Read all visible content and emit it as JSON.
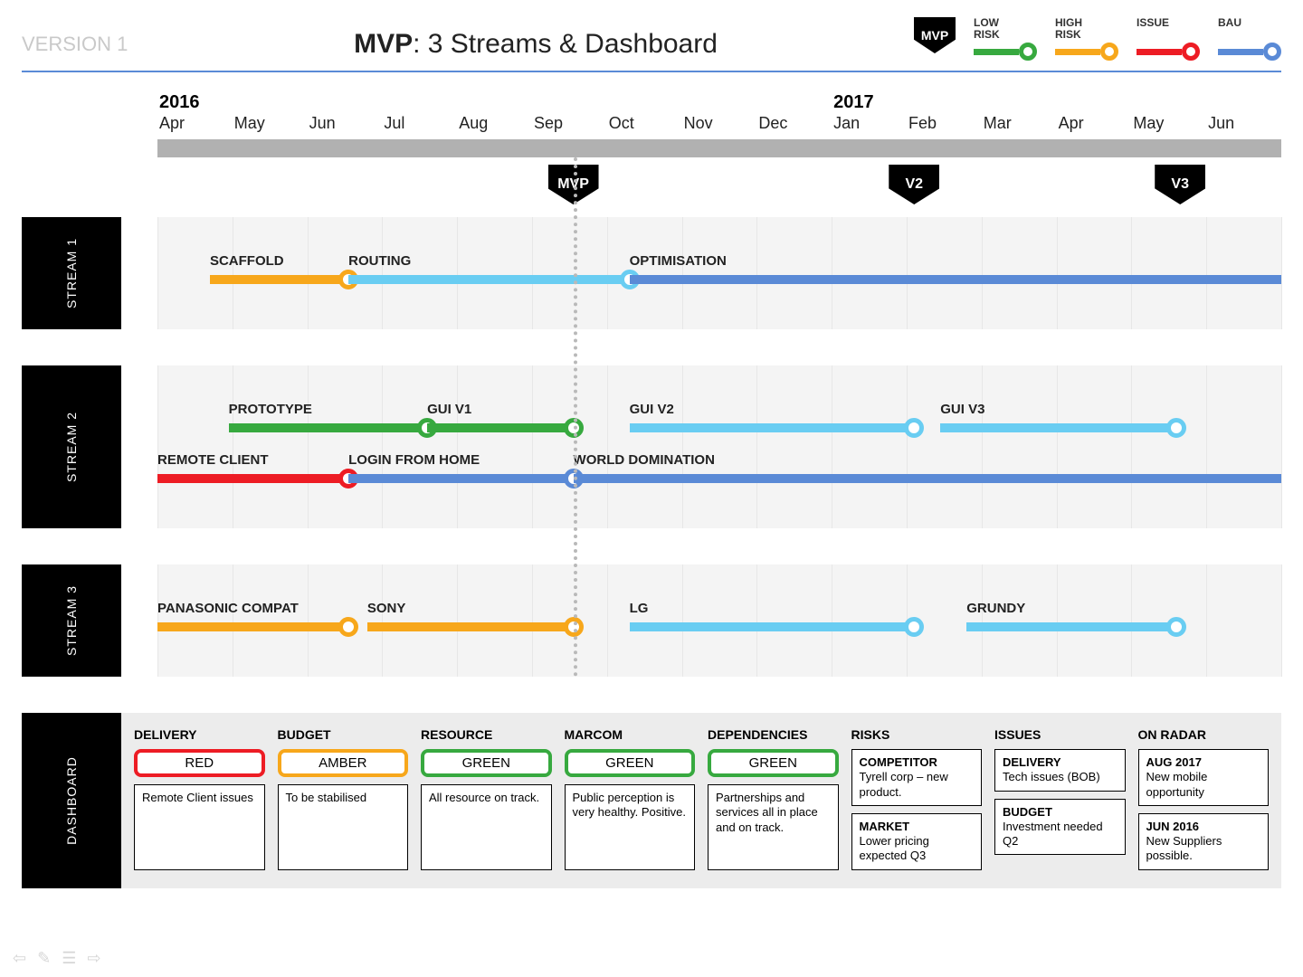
{
  "version": "VERSION 1",
  "title_bold": "MVP",
  "title_rest": ": 3 Streams & Dashboard",
  "legend": {
    "mvp": "MVP",
    "items": [
      {
        "label": "LOW\nRISK",
        "color": "#37a93f"
      },
      {
        "label": "HIGH\nRISK",
        "color": "#f7a71b"
      },
      {
        "label": "ISSUE",
        "color": "#ed1c24"
      },
      {
        "label": "BAU",
        "color": "#5a8ad6"
      }
    ]
  },
  "timeline": {
    "years": [
      {
        "at": 0,
        "label": "2016"
      },
      {
        "at": 9,
        "label": "2017"
      }
    ],
    "months": [
      "Apr",
      "May",
      "Jun",
      "Jul",
      "Aug",
      "Sep",
      "Oct",
      "Nov",
      "Dec",
      "Jan",
      "Feb",
      "Mar",
      "Apr",
      "May",
      "Jun"
    ],
    "n": 15,
    "mvp_dash_at": 5.55,
    "milestones": [
      {
        "label": "MVP",
        "at": 5.55
      },
      {
        "label": "V2",
        "at": 10.1
      },
      {
        "label": "V3",
        "at": 13.65
      }
    ]
  },
  "streams": [
    {
      "name": "STREAM 1",
      "rows": [
        [
          {
            "label": "SCAFFOLD",
            "start": 0.7,
            "end": 2.55,
            "color": "orange",
            "dot": true
          },
          {
            "label": "ROUTING",
            "start": 2.55,
            "end": 6.3,
            "color": "sky",
            "dot": true
          },
          {
            "label": "OPTIMISATION",
            "start": 6.3,
            "end": 15.0,
            "color": "blue",
            "dot": false
          }
        ]
      ]
    },
    {
      "name": "STREAM 2",
      "rows": [
        [
          {
            "label": "PROTOTYPE",
            "start": 0.95,
            "end": 3.6,
            "color": "green",
            "dot": true
          },
          {
            "label": "GUI V1",
            "start": 3.6,
            "end": 5.55,
            "color": "green",
            "dot": true
          },
          {
            "label": "GUI V2",
            "start": 6.3,
            "end": 10.1,
            "color": "sky",
            "dot": true
          },
          {
            "label": "GUI V3",
            "start": 10.45,
            "end": 13.6,
            "color": "sky",
            "dot": true
          }
        ],
        [
          {
            "label": "REMOTE CLIENT",
            "start": 0.0,
            "end": 2.55,
            "color": "red",
            "dot": true
          },
          {
            "label": "LOGIN FROM HOME",
            "start": 2.55,
            "end": 5.55,
            "color": "blue",
            "dot": true
          },
          {
            "label": "WORLD DOMINATION",
            "start": 5.55,
            "end": 15.0,
            "color": "blue",
            "dot": false
          }
        ]
      ]
    },
    {
      "name": "STREAM 3",
      "rows": [
        [
          {
            "label": "PANASONIC COMPAT",
            "start": 0.0,
            "end": 2.55,
            "color": "orange",
            "dot": true
          },
          {
            "label": "SONY",
            "start": 2.8,
            "end": 5.55,
            "color": "orange",
            "dot": true
          },
          {
            "label": "LG",
            "start": 6.3,
            "end": 10.1,
            "color": "sky",
            "dot": true
          },
          {
            "label": "GRUNDY",
            "start": 10.8,
            "end": 13.6,
            "color": "sky",
            "dot": true
          }
        ]
      ]
    }
  ],
  "dashboard": {
    "label": "DASHBOARD",
    "cols": [
      {
        "title": "DELIVERY",
        "rag": "RED",
        "rag_cls": "red",
        "text": "Remote Client issues"
      },
      {
        "title": "BUDGET",
        "rag": "AMBER",
        "rag_cls": "amber",
        "text": "To be stabilised"
      },
      {
        "title": "RESOURCE",
        "rag": "GREEN",
        "rag_cls": "green",
        "text": "All resource on track."
      },
      {
        "title": "MARCOM",
        "rag": "GREEN",
        "rag_cls": "green",
        "text": "Public perception is very healthy. Positive."
      },
      {
        "title": "DEPENDENCIES",
        "rag": "GREEN",
        "rag_cls": "green",
        "text": "Partnerships and services all in place and on track."
      }
    ],
    "risks": {
      "title": "RISKS",
      "items": [
        {
          "h": "COMPETITOR",
          "t": "Tyrell corp – new product."
        },
        {
          "h": "MARKET",
          "t": "Lower pricing expected Q3"
        }
      ]
    },
    "issues": {
      "title": "ISSUES",
      "items": [
        {
          "h": "DELIVERY",
          "t": "Tech issues (BOB)"
        },
        {
          "h": "BUDGET",
          "t": "Investment needed Q2"
        }
      ]
    },
    "radar": {
      "title": "ON RADAR",
      "items": [
        {
          "h": "AUG 2017",
          "t": "New mobile opportunity"
        },
        {
          "h": "JUN 2016",
          "t": "New Suppliers possible."
        }
      ]
    }
  },
  "chart_data": {
    "type": "gantt-roadmap",
    "x_axis": {
      "start": "2016-04",
      "end": "2017-06",
      "ticks": [
        "Apr",
        "May",
        "Jun",
        "Jul",
        "Aug",
        "Sep",
        "Oct",
        "Nov",
        "Dec",
        "Jan",
        "Feb",
        "Mar",
        "Apr",
        "May",
        "Jun"
      ]
    },
    "milestones": [
      {
        "label": "MVP",
        "month": "2016-09/10"
      },
      {
        "label": "V2",
        "month": "2017-02"
      },
      {
        "label": "V3",
        "month": "2017-05/06"
      }
    ],
    "color_semantics": {
      "green": "low risk",
      "orange": "high risk",
      "red": "issue",
      "blue": "BAU",
      "sky": "BAU"
    },
    "streams": [
      {
        "name": "STREAM 1",
        "tasks": [
          {
            "name": "SCAFFOLD",
            "start": "2016-04",
            "end": "2016-06",
            "status": "high risk"
          },
          {
            "name": "ROUTING",
            "start": "2016-06",
            "end": "2016-10",
            "status": "BAU"
          },
          {
            "name": "OPTIMISATION",
            "start": "2016-10",
            "end": "2017-06",
            "status": "BAU"
          }
        ]
      },
      {
        "name": "STREAM 2",
        "tasks": [
          {
            "name": "PROTOTYPE",
            "start": "2016-05",
            "end": "2016-07",
            "status": "low risk"
          },
          {
            "name": "GUI V1",
            "start": "2016-07",
            "end": "2016-09",
            "status": "low risk"
          },
          {
            "name": "GUI V2",
            "start": "2016-10",
            "end": "2017-02",
            "status": "BAU"
          },
          {
            "name": "GUI V3",
            "start": "2017-02",
            "end": "2017-05",
            "status": "BAU"
          },
          {
            "name": "REMOTE CLIENT",
            "start": "2016-04",
            "end": "2016-06",
            "status": "issue"
          },
          {
            "name": "LOGIN FROM HOME",
            "start": "2016-06",
            "end": "2016-09",
            "status": "BAU"
          },
          {
            "name": "WORLD DOMINATION",
            "start": "2016-09",
            "end": "2017-06",
            "status": "BAU"
          }
        ]
      },
      {
        "name": "STREAM 3",
        "tasks": [
          {
            "name": "PANASONIC COMPAT",
            "start": "2016-04",
            "end": "2016-06",
            "status": "high risk"
          },
          {
            "name": "SONY",
            "start": "2016-06",
            "end": "2016-09",
            "status": "high risk"
          },
          {
            "name": "LG",
            "start": "2016-10",
            "end": "2017-02",
            "status": "BAU"
          },
          {
            "name": "GRUNDY",
            "start": "2017-02",
            "end": "2017-05",
            "status": "BAU"
          }
        ]
      }
    ]
  }
}
